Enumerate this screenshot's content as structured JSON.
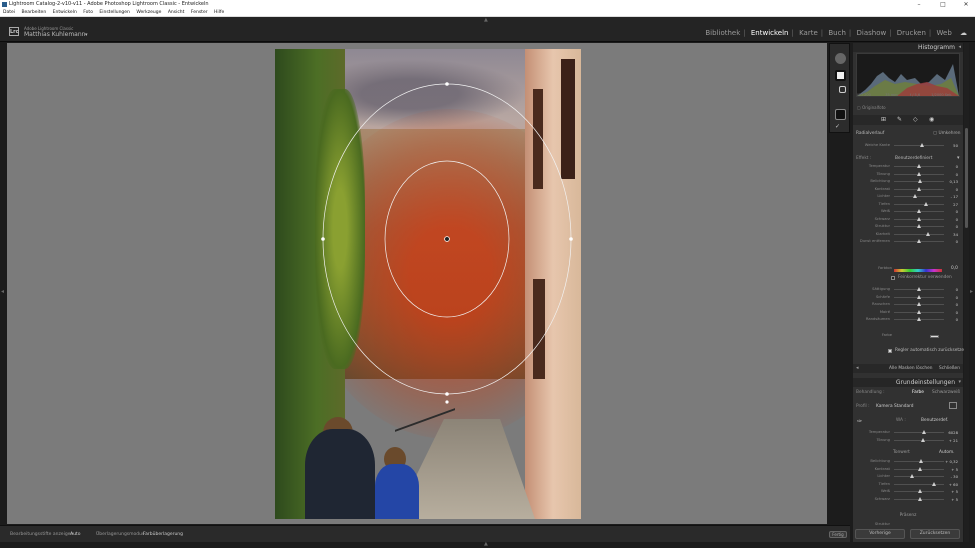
{
  "window": {
    "title": "Lightroom Catalog-2-v10-v11 - Adobe Photoshop Lightroom Classic - Entwickeln",
    "controls": [
      "–",
      "□",
      "✕"
    ]
  },
  "menu": [
    "Datei",
    "Bearbeiten",
    "Entwickeln",
    "Foto",
    "Einstellungen",
    "Werkzeuge",
    "Ansicht",
    "Fenster",
    "Hilfe"
  ],
  "identity": {
    "logo": "Lrc",
    "small": "Adobe Lightroom Classic",
    "user": "Matthias Kuhlemann"
  },
  "modules": [
    "Bibliothek",
    "Entwickeln",
    "Karte",
    "Buch",
    "Diashow",
    "Drucken",
    "Web"
  ],
  "active_module": "Entwickeln",
  "toolbar": {
    "overlay_label": "Bearbeitungsstifte anzeigen :",
    "overlay_value": "Auto",
    "mode_label": "Überlagerungsmodus :",
    "mode_value": "Farbüberlagerung",
    "done": "Fertig"
  },
  "histogram": {
    "title": "Histogramm",
    "iso": "ISO 200",
    "focal": "35 mm",
    "aperture": "f / 5,6",
    "shutter": "1/2000 Sek.",
    "original": "Originalfoto"
  },
  "mask": {
    "label": "Radialverlauf",
    "invert": "Umkehren",
    "feather_label": "Weiche Kante",
    "feather_value": "50",
    "effect_label": "Effekt :",
    "effect_value": "Benutzerdefiniert",
    "sliders": [
      {
        "label": "Temperatur",
        "value": "0",
        "level": 0.5
      },
      {
        "label": "Tönung",
        "value": "0",
        "level": 0.5
      },
      {
        "label": "Belichtung",
        "value": "0,13",
        "level": 0.52
      },
      {
        "label": "Kontrast",
        "value": "0",
        "level": 0.5
      },
      {
        "label": "Lichter",
        "value": "- 17",
        "level": 0.41
      },
      {
        "label": "Tiefen",
        "value": "27",
        "level": 0.63
      },
      {
        "label": "Weiß",
        "value": "0",
        "level": 0.5
      },
      {
        "label": "Schwarz",
        "value": "0",
        "level": 0.5
      },
      {
        "label": "Struktur",
        "value": "0",
        "level": 0.5
      },
      {
        "label": "Klarheit",
        "value": "34",
        "level": 0.67
      },
      {
        "label": "Dunst entfernen",
        "value": "0",
        "level": 0.5
      }
    ],
    "farbton_label": "Farbton",
    "farbton_value": "0,0",
    "fine_tune": "Feinkorrektur verwenden",
    "sliders2": [
      {
        "label": "Sättigung",
        "value": "0",
        "level": 0.5
      },
      {
        "label": "Schärfe",
        "value": "0",
        "level": 0.5
      },
      {
        "label": "Rauschen",
        "value": "0",
        "level": 0.5
      },
      {
        "label": "Moiré",
        "value": "0",
        "level": 0.5
      },
      {
        "label": "Randsäumen",
        "value": "0",
        "level": 0.5
      }
    ],
    "farbe_label": "Farbe",
    "auto_reset": "Regler automatisch zurücksetzen",
    "delete_all": "Alle Masken löschen",
    "close": "Schließen"
  },
  "basic": {
    "title": "Grundeinstellungen",
    "treatment_label": "Behandlung :",
    "color": "Farbe",
    "bw": "Schwarzweiß",
    "profile_label": "Profil :",
    "profile_value": "Kamera Standard",
    "wb_label": "WA :",
    "wb_value": "Benutzerdef.",
    "wb_sliders": [
      {
        "label": "Temperatur",
        "value": "6028",
        "level": 0.6
      },
      {
        "label": "Tönung",
        "value": "+ 21",
        "level": 0.58
      }
    ],
    "tone_label": "Tonwert",
    "auto": "Autom.",
    "tone_sliders": [
      {
        "label": "Belichtung",
        "value": "+ 0,32",
        "level": 0.53
      },
      {
        "label": "Kontrast",
        "value": "+ 5",
        "level": 0.52
      },
      {
        "label": "Lichter",
        "value": "- 30",
        "level": 0.35
      },
      {
        "label": "Tiefen",
        "value": "+ 60",
        "level": 0.8
      },
      {
        "label": "Weiß",
        "value": "+ 5",
        "level": 0.52
      },
      {
        "label": "Schwarz",
        "value": "+ 5",
        "level": 0.52
      }
    ],
    "presence": "Präsenz",
    "last_label": "Struktur"
  },
  "buttons": {
    "previous": "Vorherige",
    "reset": "Zurücksetzen"
  },
  "colors": {
    "accent_active": "#ffffff",
    "panel_bg": "#313131",
    "canvas_bg": "#7b7b7b"
  }
}
